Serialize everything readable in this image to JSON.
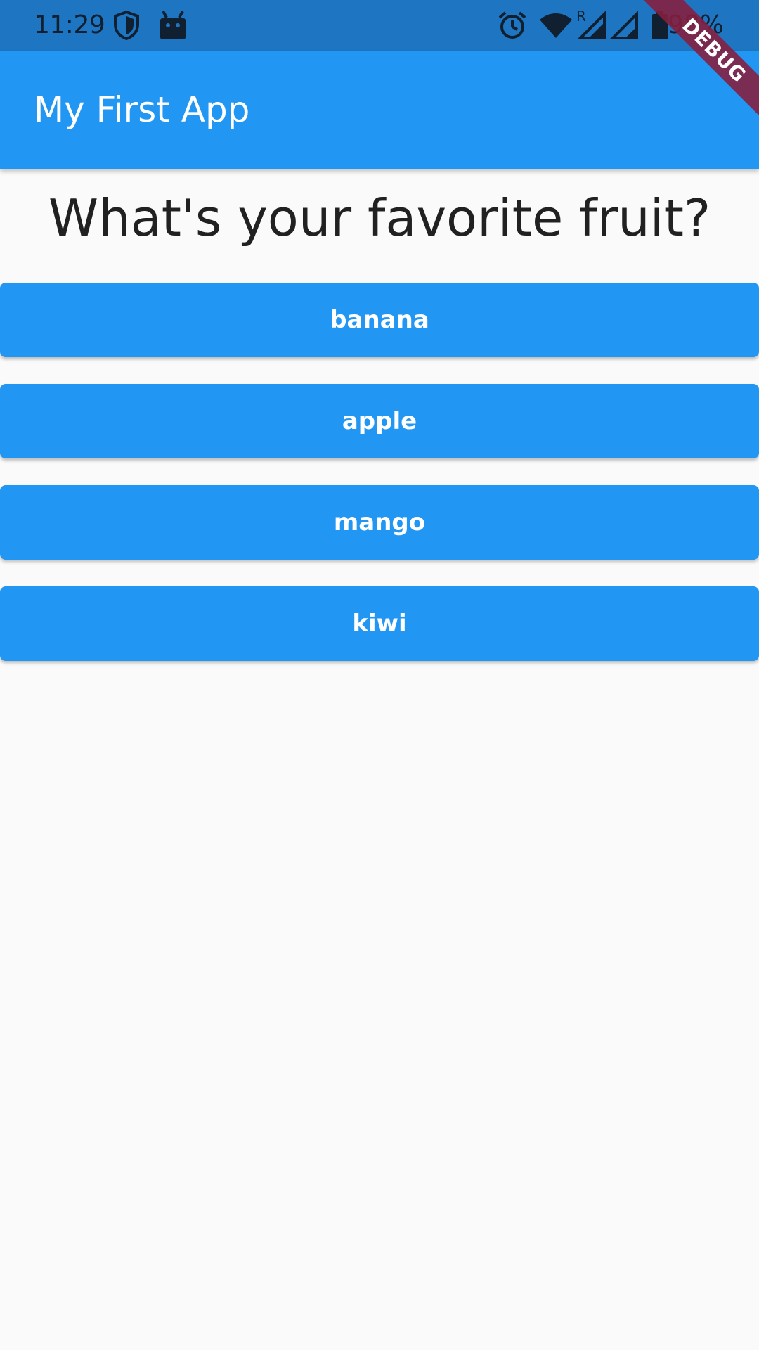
{
  "status_bar": {
    "time": "11:29",
    "battery_text": "98%",
    "icons": [
      "shield-icon",
      "android-debug-icon",
      "alarm-icon",
      "wifi-icon",
      "roaming-indicator-icon",
      "signal-icon",
      "signal-secondary-icon",
      "battery-icon"
    ],
    "roaming_label": "R"
  },
  "app_bar": {
    "title": "My First App"
  },
  "debug_banner": {
    "label": "DEBUG"
  },
  "main": {
    "question": "What's your favorite fruit?",
    "answers": [
      {
        "label": "banana"
      },
      {
        "label": "apple"
      },
      {
        "label": "mango"
      },
      {
        "label": "kiwi"
      }
    ]
  },
  "colors": {
    "status_bar": "#1e76c2",
    "app_bar": "#2196f3",
    "button": "#2196f3",
    "background": "#fafafa",
    "text_dark": "#212121",
    "debug_banner": "#881e3c"
  }
}
